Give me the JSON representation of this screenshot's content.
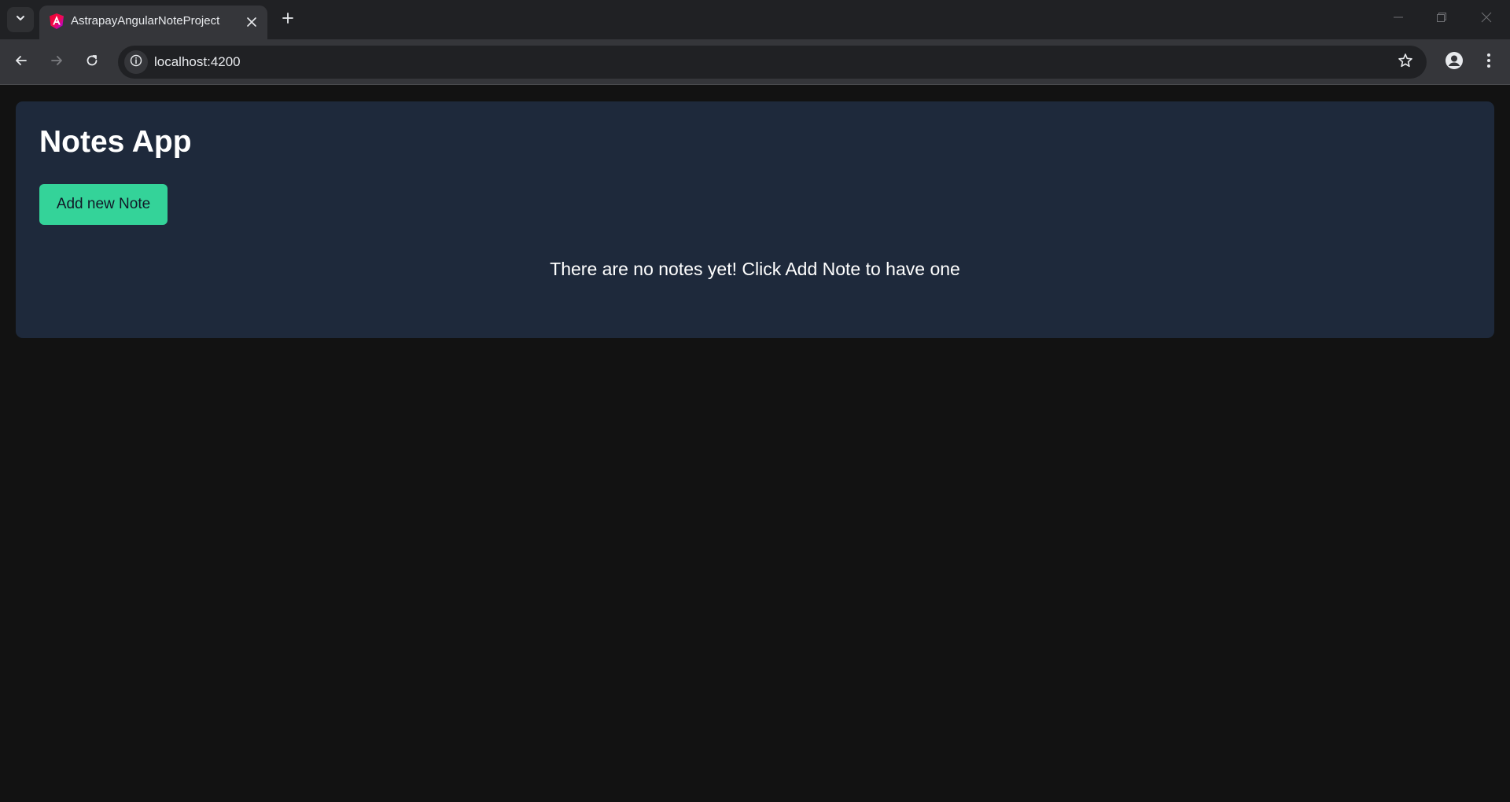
{
  "browser": {
    "tab": {
      "title": "AstrapayAngularNoteProject",
      "favicon": "angular-logo-icon"
    },
    "address_bar": {
      "url": "localhost:4200"
    },
    "icons": {
      "tab_search": "chevron-down-icon",
      "tab_close": "close-icon",
      "new_tab": "plus-icon",
      "back": "arrow-left-icon",
      "forward": "arrow-right-icon",
      "reload": "reload-icon",
      "site_info": "info-icon",
      "bookmark": "star-icon",
      "profile": "person-icon",
      "menu": "kebab-menu-icon",
      "minimize": "minimize-icon",
      "restore": "restore-icon",
      "close_window": "close-icon"
    }
  },
  "app": {
    "title": "Notes App",
    "add_button_label": "Add new Note",
    "empty_message": "There are no notes yet! Click Add Note to have one"
  },
  "colors": {
    "page_background": "#121212",
    "card_background": "#1e293b",
    "button_accent": "#34d399",
    "button_text": "#111827",
    "text": "#ffffff"
  }
}
